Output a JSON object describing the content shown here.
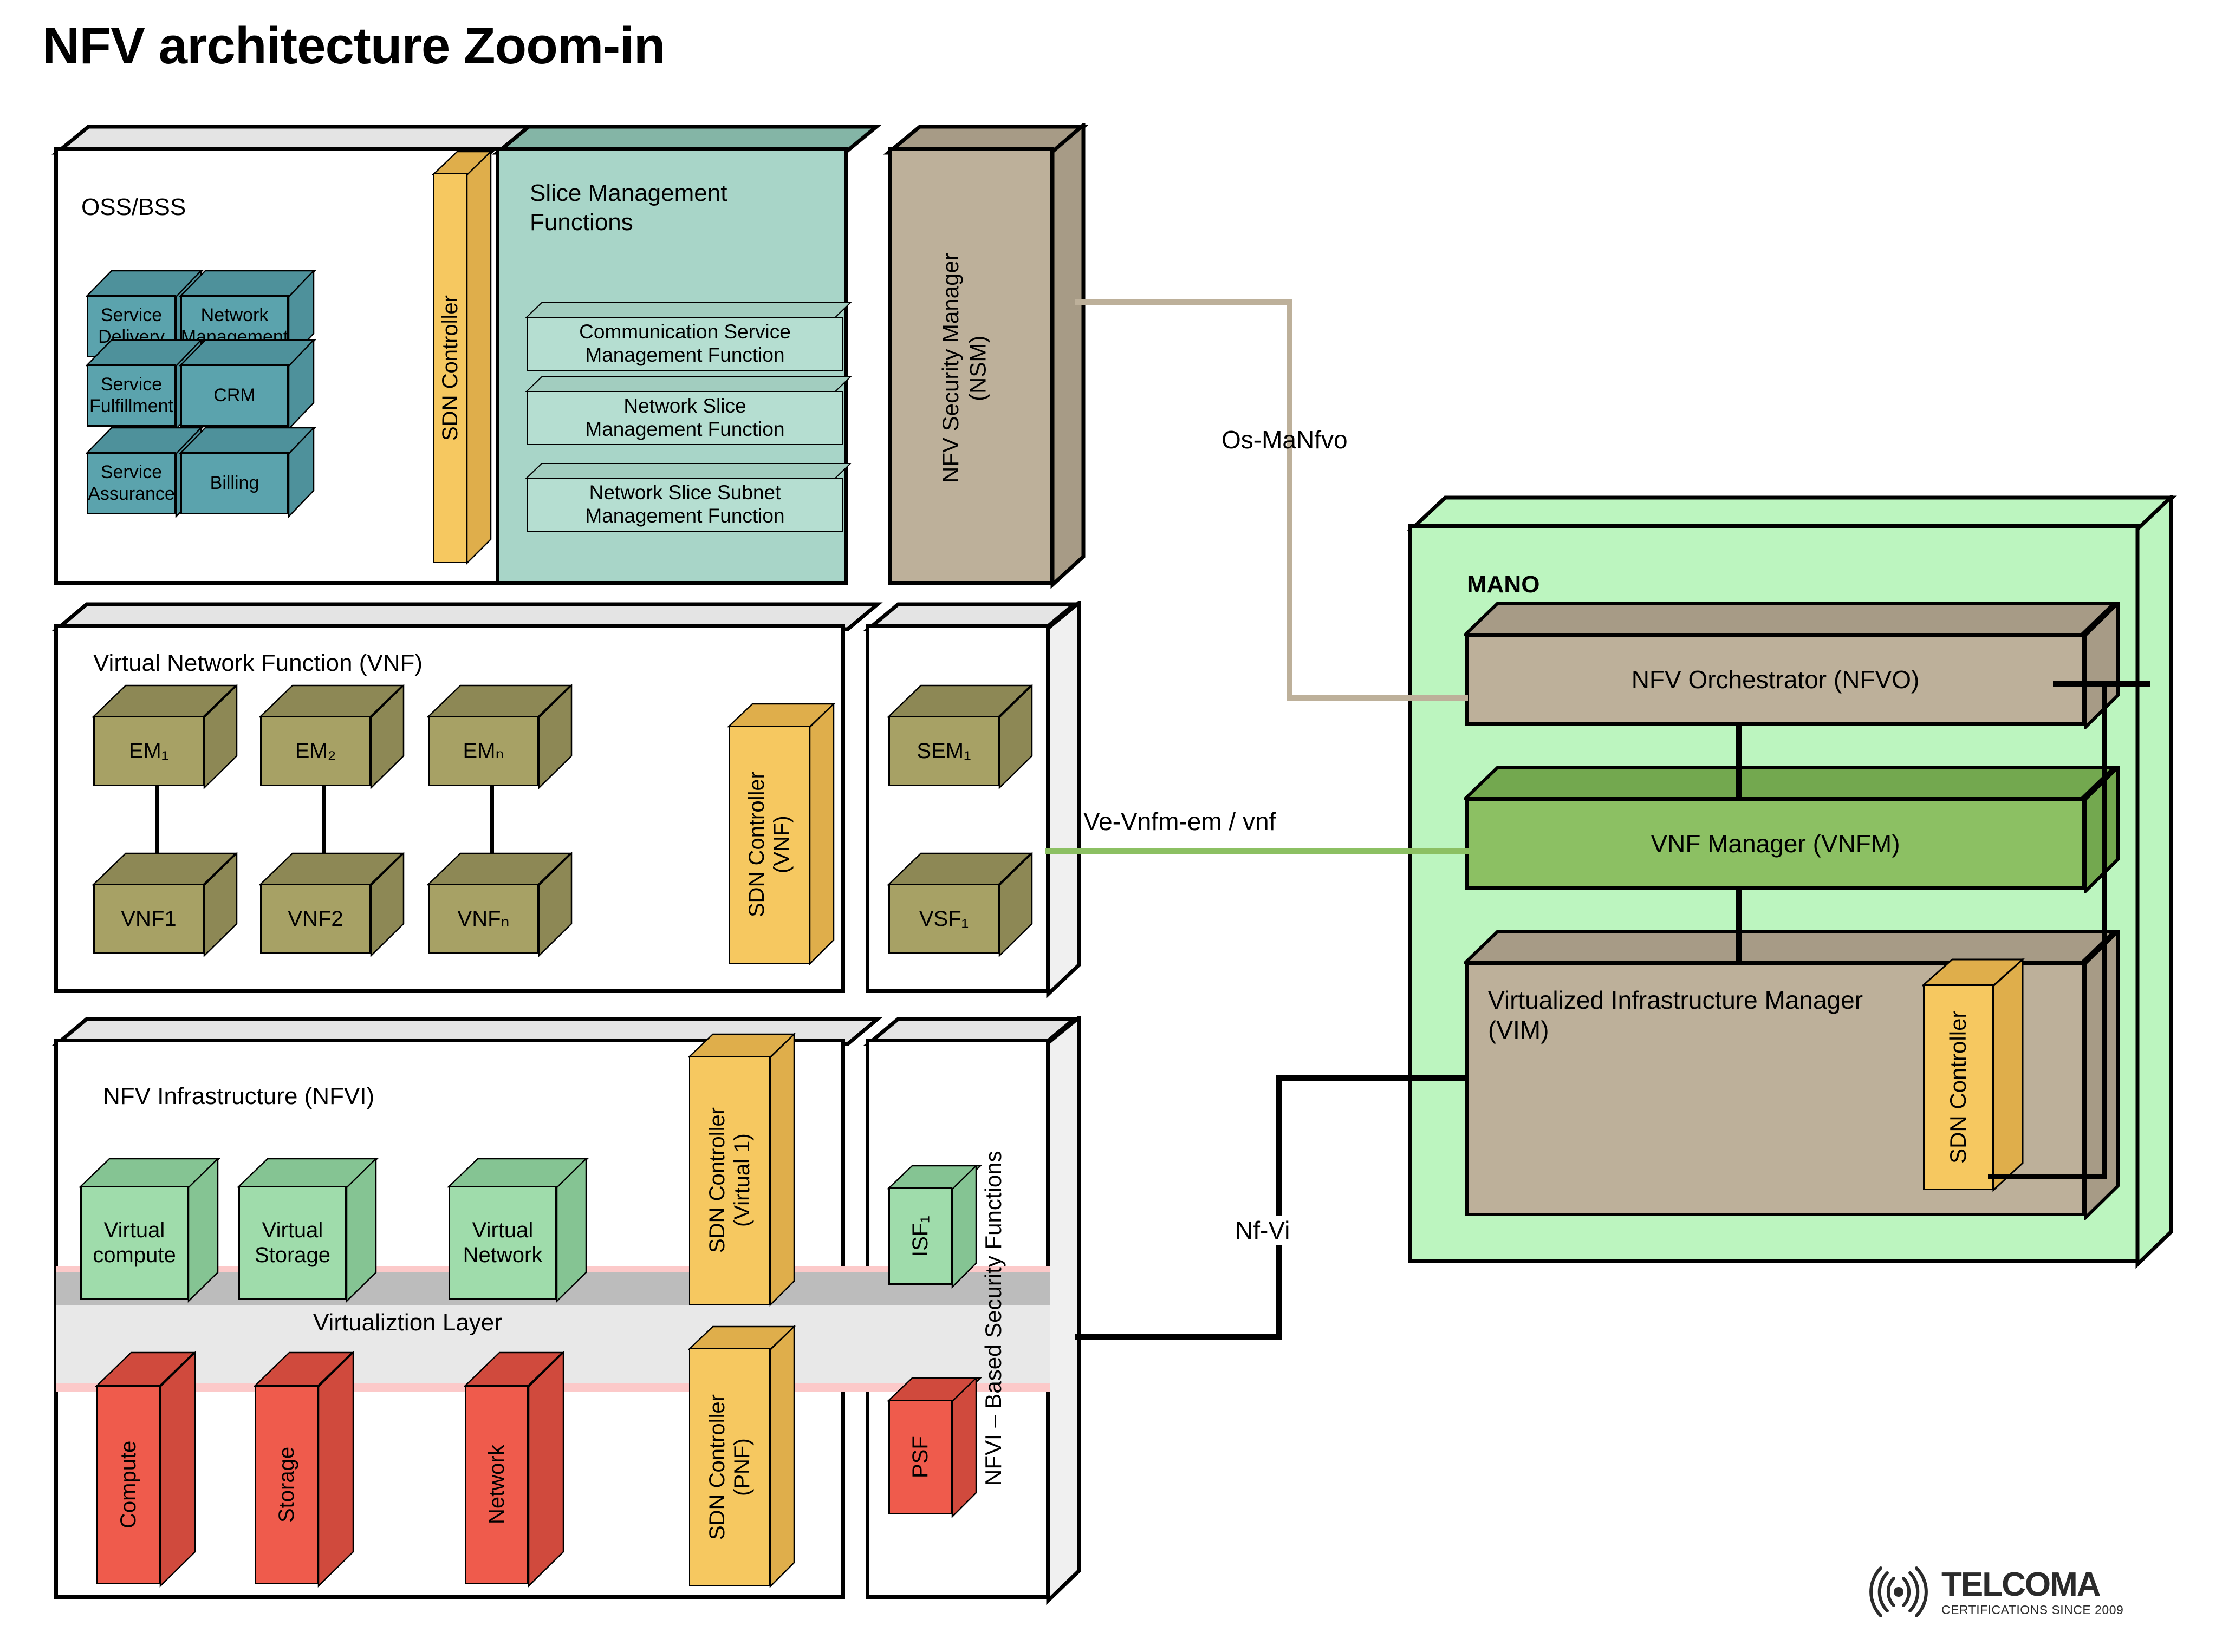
{
  "title": "NFV architecture Zoom-in",
  "colors": {
    "teal_box": "#5ba3ad",
    "teal_box_top": "#4e919b",
    "slice_panel": "#a8d5c8",
    "slice_panel_top": "#84b5a6",
    "slice_sub": "#b5ded1",
    "nsm": "#bdb09a",
    "nsm_top": "#a79b86",
    "olive": "#a7a165",
    "olive_top": "#8d8855",
    "amber": "#f6c860",
    "amber_top": "#dfae4b",
    "green_box": "#9fdcab",
    "green_box_top": "#85c493",
    "red_box": "#ef5b4c",
    "red_box_top": "#d04a3d",
    "mano_bg": "#bcf5bf",
    "mano_inner_tan": "#bdb09a",
    "mano_vnfm": "#8cc063",
    "shell_top": "#e4e4e4",
    "shell_right": "#f0f0f0",
    "virt_layer": "#e6e6e6",
    "virt_layer_edge": "#fcc9c9",
    "connector_os": "#bdb09a",
    "connector_ve": "#8cc063",
    "connector_nf": "#000000"
  },
  "oss_bss": {
    "label": "OSS/BSS",
    "boxes": [
      "Service\nDelivery",
      "Network\nManagement",
      "Service\nFulfillment",
      "CRM",
      "Service\nAssurance",
      "Billing"
    ],
    "sdn_controller": "SDN Controller"
  },
  "slice_management": {
    "title": "Slice Management\nFunctions",
    "functions": [
      "Communication Service\nManagement Function",
      "Network Slice\nManagement Function",
      "Network Slice Subnet\nManagement Function"
    ]
  },
  "nsm": {
    "label": "NFV Security Manager\n(NSM)"
  },
  "vnf": {
    "title": "Virtual Network Function (VNF)",
    "em_row": [
      "EM₁",
      "EM₂",
      "EMₙ"
    ],
    "vnf_row": [
      "VNF1",
      "VNF2",
      "VNFₙ"
    ],
    "sdn_controller": "SDN Controller\n(VNF)",
    "sem": "SEM₁",
    "vsf": "VSF₁"
  },
  "nfvi": {
    "title": "NFV Infrastructure (NFVI)",
    "virtual_resources": [
      "Virtual\ncompute",
      "Virtual\nStorage",
      "Virtual\nNetwork"
    ],
    "physical_resources": [
      "Compute",
      "Storage",
      "Network"
    ],
    "virtualization_layer": "Virtualiztion Layer",
    "sdn_controller_virtual": "SDN Controller\n(Virtual 1)",
    "sdn_controller_pnf": "SDN Controller\n(PNF)",
    "security_column_label": "NFVI – Based Security Functions",
    "isf": "ISF₁",
    "psf": "PSF"
  },
  "mano": {
    "label": "MANO",
    "nfvo": "NFV Orchestrator (NFVO)",
    "vnfm": "VNF Manager (VNFM)",
    "vim": "Virtualized Infrastructure Manager\n(VIM)",
    "sdn_controller": "SDN Controller"
  },
  "interfaces": {
    "os_ma_nfvo": "Os-MaNfvo",
    "ve_vnfm": "Ve-Vnfm-em / vnf",
    "nf_vi": "Nf-Vi"
  },
  "branding": {
    "name": "TELCOMA",
    "tagline": "CERTIFICATIONS SINCE 2009"
  }
}
